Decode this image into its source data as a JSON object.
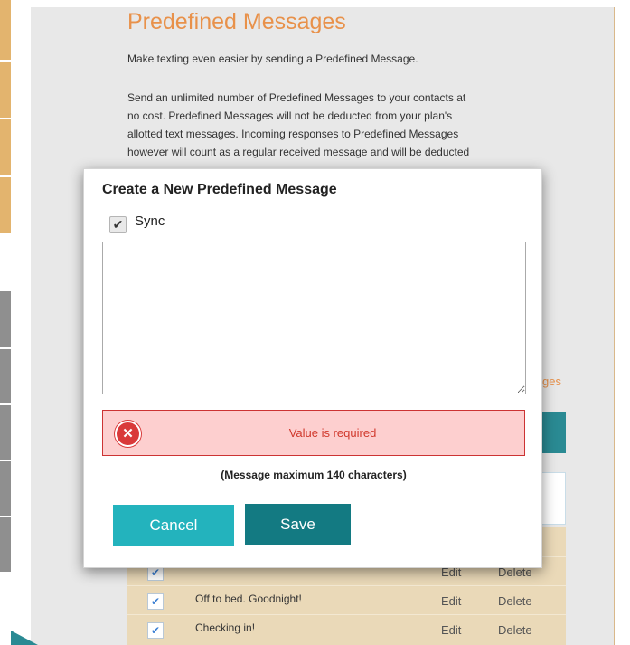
{
  "page": {
    "title": "Predefined Messages",
    "intro": "Make texting even easier by sending a Predefined Message.",
    "paragraph_lines": [
      "Send an unlimited number of Predefined Messages to your contacts at",
      "no cost.  Predefined Messages will not be deducted from your plan's",
      "allotted text messages. Incoming responses to Predefined Messages",
      "however will count as a regular received message and will be deducted"
    ],
    "peek_link": "ges"
  },
  "messages": [
    {
      "text": "Off to bed. Goodnight!",
      "checked": true,
      "edit": "Edit",
      "delete": "Delete"
    },
    {
      "text": "Checking in!",
      "checked": true,
      "edit": "Edit",
      "delete": "Delete"
    }
  ],
  "partial_row": {
    "edit": "Edit",
    "delete": "Delete"
  },
  "modal": {
    "title": "Create a New Predefined Message",
    "sync_label": "Sync",
    "sync_checked": true,
    "message_value": "",
    "error_text": "Value is required",
    "max_note": "(Message maximum 140 characters)",
    "cancel_label": "Cancel",
    "save_label": "Save"
  },
  "icons": {
    "checkbox": "checkmark-icon",
    "error": "error-x-icon"
  },
  "colors": {
    "title_orange": "#e8914a",
    "teal_dark": "#137a82",
    "teal_light": "#23b3bd",
    "error_red": "#d0382c",
    "error_bg": "#fdcfcf",
    "table_bg": "#ead9b8"
  }
}
